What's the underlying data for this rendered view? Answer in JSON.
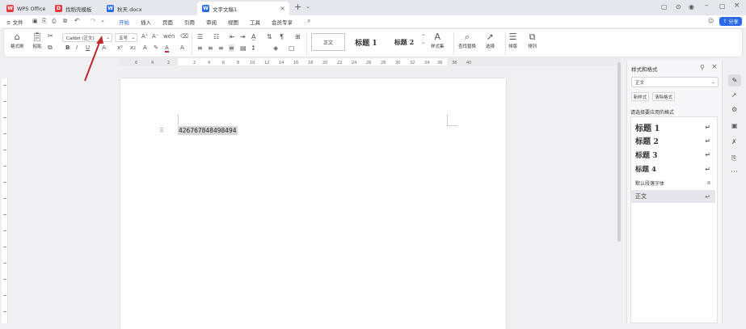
{
  "titlebar": {
    "tabs": [
      {
        "label": "WPS Office",
        "icon": "wps-logo-icon",
        "color": "#e03a3e"
      },
      {
        "label": "找稻壳模板",
        "icon": "docer-icon",
        "color": "#e03a3e"
      },
      {
        "label": "秋天.docx",
        "icon": "word-doc-icon",
        "color": "#2a6ae9"
      },
      {
        "label": "文字文稿1",
        "icon": "word-doc-icon",
        "color": "#2a6ae9"
      }
    ],
    "share_label": "分享"
  },
  "menubar": {
    "file_label": "≡ 文件",
    "items": [
      "开始",
      "插入",
      "页面",
      "引用",
      "审阅",
      "视图",
      "工具",
      "会员专享"
    ]
  },
  "ribbon": {
    "format_painter": "格式刷",
    "paste": "粘贴",
    "font_name": "Calibri (正文)",
    "font_size": "五号",
    "styles_gallery": [
      "正文",
      "标题 1",
      "标题 2"
    ],
    "style_set": "样式集",
    "find_replace": "查找替换",
    "select": "选择",
    "layout": "排版",
    "arrange": "排列"
  },
  "document": {
    "text": "426767848498494"
  },
  "panel": {
    "title": "样式和格式",
    "current_style": "正文",
    "new_style": "新样式",
    "clear_format": "清除格式",
    "prompt": "请选择要应用的格式",
    "styles": [
      {
        "label": "标题 1"
      },
      {
        "label": "标题 2"
      },
      {
        "label": "标题 3"
      },
      {
        "label": "标题 4"
      },
      {
        "label": "默认段落字体"
      },
      {
        "label": "正文"
      }
    ]
  },
  "colors": {
    "accent": "#2a6ae9",
    "arrow": "#c0282d"
  }
}
